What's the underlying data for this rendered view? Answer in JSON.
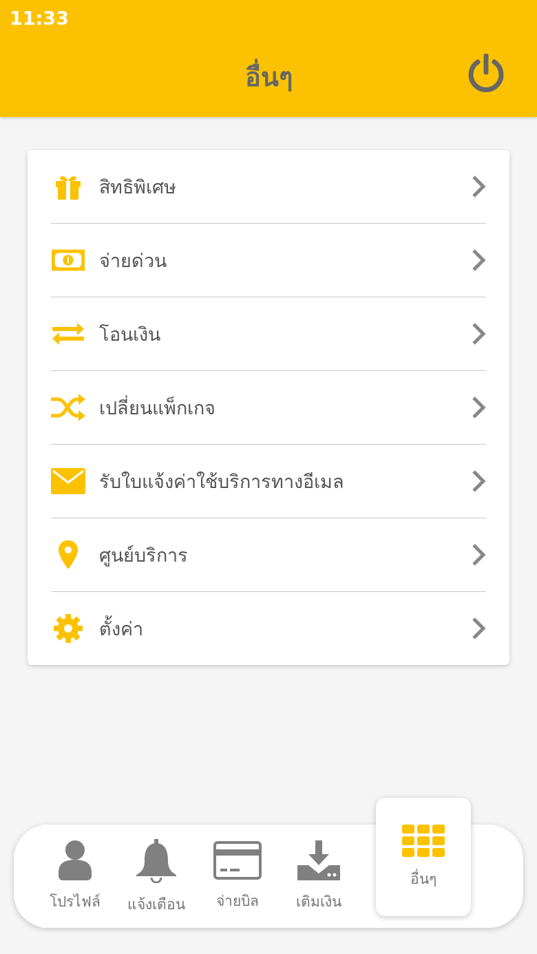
{
  "status_bar": {
    "time": "11:33"
  },
  "header": {
    "title": "อื่นๆ"
  },
  "menu": [
    {
      "kind": "gift",
      "label": "สิทธิพิเศษ"
    },
    {
      "kind": "cash",
      "label": "จ่ายด่วน"
    },
    {
      "kind": "transfer",
      "label": "โอนเงิน"
    },
    {
      "kind": "shuffle",
      "label": "เปลี่ยนแพ็กเกจ"
    },
    {
      "kind": "mail",
      "label": "รับใบแจ้งค่าใช้บริการทางอีเมล"
    },
    {
      "kind": "pin",
      "label": "ศูนย์บริการ"
    },
    {
      "kind": "gear",
      "label": "ตั้งค่า"
    }
  ],
  "bottom_nav": [
    {
      "kind": "profile",
      "label": "โปรไฟล์",
      "selected": false
    },
    {
      "kind": "bell",
      "label": "แจ้งเตือน",
      "selected": false
    },
    {
      "kind": "card",
      "label": "จ่ายบิล",
      "selected": false
    },
    {
      "kind": "download",
      "label": "เติมเงิน",
      "selected": false
    },
    {
      "kind": "grid",
      "label": "อื่นๆ",
      "selected": true
    }
  ]
}
